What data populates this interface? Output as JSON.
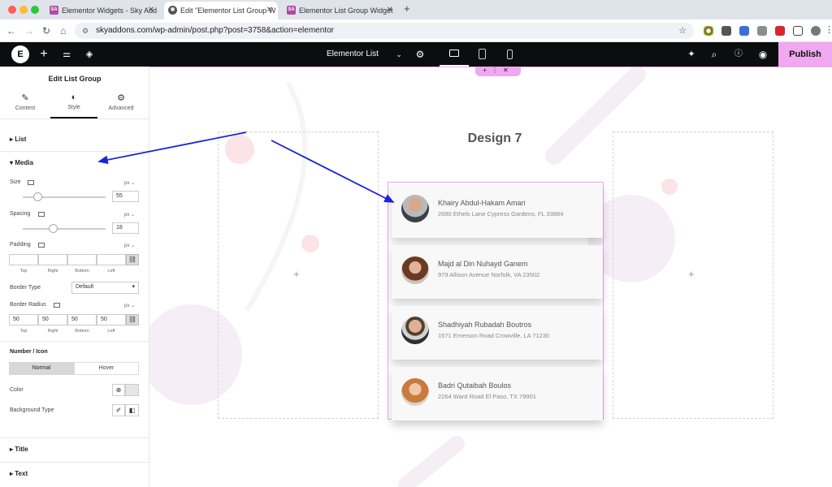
{
  "browser": {
    "tabs": [
      {
        "label": "Elementor Widgets - Sky Add",
        "active": false
      },
      {
        "label": "Edit \"Elementor List Group W",
        "active": true
      },
      {
        "label": "Elementor List Group Widget",
        "active": false
      }
    ],
    "url": "skyaddons.com/wp-admin/post.php?post=3758&action=elementor"
  },
  "topbar": {
    "page_title": "Elementor List Gr...",
    "publish": "Publish"
  },
  "panel": {
    "title": "Edit List Group",
    "tabs": [
      "Content",
      "Style",
      "Advanced"
    ],
    "sections": {
      "list": "List",
      "media": "Media",
      "title": "Title",
      "text": "Text"
    },
    "size": {
      "label": "Size",
      "unit": "px",
      "value": "55",
      "slider": 0.18
    },
    "spacing": {
      "label": "Spacing",
      "unit": "px",
      "value": "18",
      "slider": 0.36
    },
    "padding": {
      "label": "Padding",
      "unit": "px",
      "values": [
        "",
        "",
        "",
        ""
      ],
      "sublabels": [
        "Top",
        "Right",
        "Bottom",
        "Left"
      ]
    },
    "border_type": {
      "label": "Border Type",
      "value": "Default"
    },
    "border_radius": {
      "label": "Border Radius",
      "unit": "px",
      "values": [
        "50",
        "50",
        "50",
        "50"
      ],
      "sublabels": [
        "Top",
        "Right",
        "Bottom",
        "Left"
      ]
    },
    "number_icon": {
      "label": "Number / Icon",
      "normal": "Normal",
      "hover": "Hover"
    },
    "color": {
      "label": "Color"
    },
    "bg_type": {
      "label": "Background Type"
    }
  },
  "canvas": {
    "heading": "Design 7",
    "items": [
      {
        "name": "Khairy Abdul-Hakam Amari",
        "address": "2680 Ethels Lane Cypress Gardens, FL 33884"
      },
      {
        "name": "Majd al Din Nuhayd Ganem",
        "address": "979 Allison Avenue Norfolk, VA 23502"
      },
      {
        "name": "Shadhiyah Rubadah Boutros",
        "address": "1571 Emerson Road Crowville, LA 71230"
      },
      {
        "name": "Badri Qutaibah Boulos",
        "address": "2264 Ward Road El Paso, TX 79901"
      }
    ]
  },
  "colors": {
    "accent": "#f0a8f0",
    "arrow": "#1a24d6",
    "topbar": "#0c0d0e"
  }
}
